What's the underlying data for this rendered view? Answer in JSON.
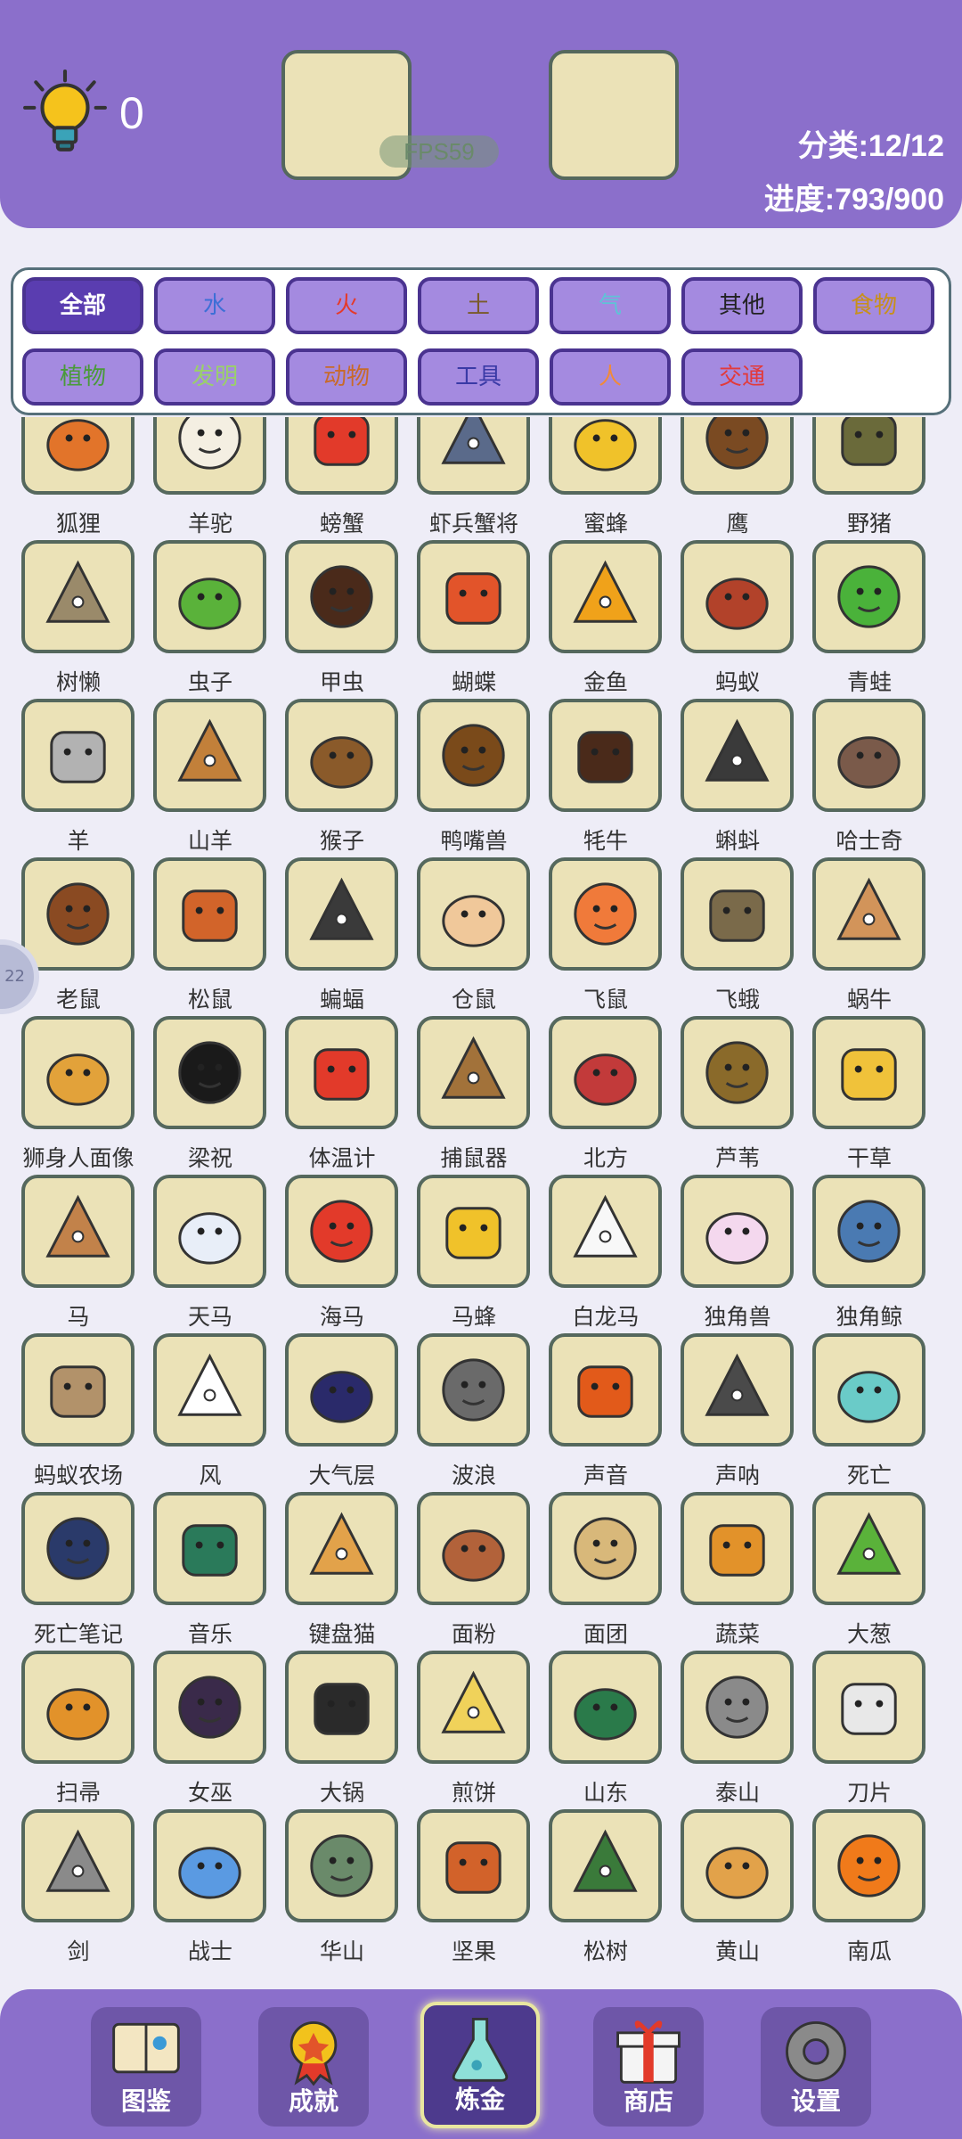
{
  "hud": {
    "hint_count": "0",
    "fps": "FPS59",
    "category": "分类:12/12",
    "progress": "进度:793/900"
  },
  "categories": [
    {
      "label": "全部",
      "color": "#ffffff",
      "bg": "#5a3db0",
      "selected": true
    },
    {
      "label": "水",
      "color": "#3d6fd6",
      "bg": "#a48ae0"
    },
    {
      "label": "火",
      "color": "#e53a2a",
      "bg": "#a48ae0"
    },
    {
      "label": "土",
      "color": "#7a5a2a",
      "bg": "#a48ae0"
    },
    {
      "label": "气",
      "color": "#5fc3d6",
      "bg": "#a48ae0"
    },
    {
      "label": "其他",
      "color": "#222222",
      "bg": "#a48ae0"
    },
    {
      "label": "食物",
      "color": "#c8901a",
      "bg": "#a48ae0"
    },
    {
      "label": "植物",
      "color": "#4a9a3a",
      "bg": "#a48ae0"
    },
    {
      "label": "发明",
      "color": "#9ad06a",
      "bg": "#a48ae0"
    },
    {
      "label": "动物",
      "color": "#c86a2a",
      "bg": "#a48ae0"
    },
    {
      "label": "工具",
      "color": "#3a3aa6",
      "bg": "#a48ae0"
    },
    {
      "label": "人",
      "color": "#f08a3a",
      "bg": "#a48ae0"
    },
    {
      "label": "交通",
      "color": "#e23a3a",
      "bg": "#a48ae0"
    }
  ],
  "items": [
    {
      "name": "狐狸",
      "icon": "fox-icon",
      "color": "#e2742a"
    },
    {
      "name": "羊驼",
      "icon": "alpaca-icon",
      "color": "#f4efe2"
    },
    {
      "name": "螃蟹",
      "icon": "crab-icon",
      "color": "#e23a2a"
    },
    {
      "name": "虾兵蟹将",
      "icon": "shrimp-soldiers-icon",
      "color": "#5a6a8a"
    },
    {
      "name": "蜜蜂",
      "icon": "bee-icon",
      "color": "#f0c22a"
    },
    {
      "name": "鹰",
      "icon": "eagle-icon",
      "color": "#7a4a22"
    },
    {
      "name": "野猪",
      "icon": "boar-icon",
      "color": "#6a6a3a"
    },
    {
      "name": "树懒",
      "icon": "sloth-icon",
      "color": "#9a8a6a"
    },
    {
      "name": "虫子",
      "icon": "caterpillar-icon",
      "color": "#5ab23a"
    },
    {
      "name": "甲虫",
      "icon": "beetle-icon",
      "color": "#4a2a1a"
    },
    {
      "name": "蝴蝶",
      "icon": "butterfly-icon",
      "color": "#e2542a"
    },
    {
      "name": "金鱼",
      "icon": "goldfish-icon",
      "color": "#f0a21a"
    },
    {
      "name": "蚂蚁",
      "icon": "ant-icon",
      "color": "#b2422a"
    },
    {
      "name": "青蛙",
      "icon": "frog-icon",
      "color": "#4ab23a"
    },
    {
      "name": "羊",
      "icon": "goat-icon",
      "color": "#b2b2b2"
    },
    {
      "name": "山羊",
      "icon": "mountain-goat-icon",
      "color": "#c2803a"
    },
    {
      "name": "猴子",
      "icon": "monkey-icon",
      "color": "#8a5a2a"
    },
    {
      "name": "鸭嘴兽",
      "icon": "platypus-icon",
      "color": "#7a4a1a"
    },
    {
      "name": "牦牛",
      "icon": "yak-icon",
      "color": "#4a2a1a"
    },
    {
      "name": "蝌蚪",
      "icon": "tadpole-icon",
      "color": "#3a3a3a"
    },
    {
      "name": "哈士奇",
      "icon": "husky-icon",
      "color": "#7a5a4a"
    },
    {
      "name": "老鼠",
      "icon": "rat-icon",
      "color": "#8a4a22"
    },
    {
      "name": "松鼠",
      "icon": "squirrel-icon",
      "color": "#d2642a"
    },
    {
      "name": "蝙蝠",
      "icon": "bat-icon",
      "color": "#3a3a3a"
    },
    {
      "name": "仓鼠",
      "icon": "hamster-icon",
      "color": "#f0c89a"
    },
    {
      "name": "飞鼠",
      "icon": "flying-squirrel-icon",
      "color": "#f07a3a"
    },
    {
      "name": "飞蛾",
      "icon": "moth-icon",
      "color": "#7a6a4a"
    },
    {
      "name": "蜗牛",
      "icon": "snail-icon",
      "color": "#d2945a"
    },
    {
      "name": "狮身人面像",
      "icon": "sphinx-icon",
      "color": "#e2a23a"
    },
    {
      "name": "梁祝",
      "icon": "butterfly-lovers-icon",
      "color": "#1a1a1a"
    },
    {
      "name": "体温计",
      "icon": "thermometer-icon",
      "color": "#e23a2a"
    },
    {
      "name": "捕鼠器",
      "icon": "mousetrap-icon",
      "color": "#a2723a"
    },
    {
      "name": "北方",
      "icon": "temple-icon",
      "color": "#c23a3a"
    },
    {
      "name": "芦苇",
      "icon": "reed-icon",
      "color": "#8a6a2a"
    },
    {
      "name": "干草",
      "icon": "hay-icon",
      "color": "#f0c23a"
    },
    {
      "name": "马",
      "icon": "horse-icon",
      "color": "#c2824a"
    },
    {
      "name": "天马",
      "icon": "pegasus-icon",
      "color": "#e8eef8"
    },
    {
      "name": "海马",
      "icon": "seahorse-icon",
      "color": "#e23a2a"
    },
    {
      "name": "马蜂",
      "icon": "wasp-icon",
      "color": "#f0c22a"
    },
    {
      "name": "白龙马",
      "icon": "white-horse-icon",
      "color": "#f8f8f8"
    },
    {
      "name": "独角兽",
      "icon": "unicorn-icon",
      "color": "#f4d8ee"
    },
    {
      "name": "独角鲸",
      "icon": "narwhal-icon",
      "color": "#4a7ab2"
    },
    {
      "name": "蚂蚁农场",
      "icon": "ant-farm-icon",
      "color": "#b2926a"
    },
    {
      "name": "风",
      "icon": "wind-icon",
      "color": "#ffffff"
    },
    {
      "name": "大气层",
      "icon": "atmosphere-icon",
      "color": "#2a2a6a"
    },
    {
      "name": "波浪",
      "icon": "wave-icon",
      "color": "#6a6a6a"
    },
    {
      "name": "声音",
      "icon": "sound-icon",
      "color": "#e25a1a"
    },
    {
      "name": "声呐",
      "icon": "sonar-icon",
      "color": "#4a4a4a"
    },
    {
      "name": "死亡",
      "icon": "skull-icon",
      "color": "#6acbc8"
    },
    {
      "name": "死亡笔记",
      "icon": "death-note-icon",
      "color": "#2a3a6a"
    },
    {
      "name": "音乐",
      "icon": "music-icon",
      "color": "#2a7a5a"
    },
    {
      "name": "键盘猫",
      "icon": "keyboard-cat-icon",
      "color": "#e2a24a"
    },
    {
      "name": "面粉",
      "icon": "flour-icon",
      "color": "#b2623a"
    },
    {
      "name": "面团",
      "icon": "dough-icon",
      "color": "#d8b87a"
    },
    {
      "name": "蔬菜",
      "icon": "vegetables-icon",
      "color": "#e2922a"
    },
    {
      "name": "大葱",
      "icon": "scallion-icon",
      "color": "#5ab23a"
    },
    {
      "name": "扫帚",
      "icon": "broom-icon",
      "color": "#e2922a"
    },
    {
      "name": "女巫",
      "icon": "witch-icon",
      "color": "#3a2a4a"
    },
    {
      "name": "大锅",
      "icon": "cauldron-icon",
      "color": "#2a2a2a"
    },
    {
      "name": "煎饼",
      "icon": "pancake-icon",
      "color": "#f0d25a"
    },
    {
      "name": "山东",
      "icon": "shandong-sign-icon",
      "color": "#2a7a4a"
    },
    {
      "name": "泰山",
      "icon": "taishan-icon",
      "color": "#8a8a8a"
    },
    {
      "name": "刀片",
      "icon": "blade-icon",
      "color": "#e8e8e8"
    },
    {
      "name": "剑",
      "icon": "sword-icon",
      "color": "#8a8a8a"
    },
    {
      "name": "战士",
      "icon": "warrior-icon",
      "color": "#5a9ae2"
    },
    {
      "name": "华山",
      "icon": "huashan-icon",
      "color": "#6a8a6a"
    },
    {
      "name": "坚果",
      "icon": "acorn-icon",
      "color": "#d2622a"
    },
    {
      "name": "松树",
      "icon": "pine-icon",
      "color": "#3a7a3a"
    },
    {
      "name": "黄山",
      "icon": "huangshan-icon",
      "color": "#e2a24a"
    },
    {
      "name": "南瓜",
      "icon": "pumpkin-icon",
      "color": "#f07a1a"
    }
  ],
  "nav": [
    {
      "label": "图鉴",
      "icon": "book-icon"
    },
    {
      "label": "成就",
      "icon": "medal-icon"
    },
    {
      "label": "炼金",
      "icon": "flask-icon",
      "active": true
    },
    {
      "label": "商店",
      "icon": "gift-icon"
    },
    {
      "label": "设置",
      "icon": "gear-icon"
    }
  ],
  "side_bubble": "22"
}
